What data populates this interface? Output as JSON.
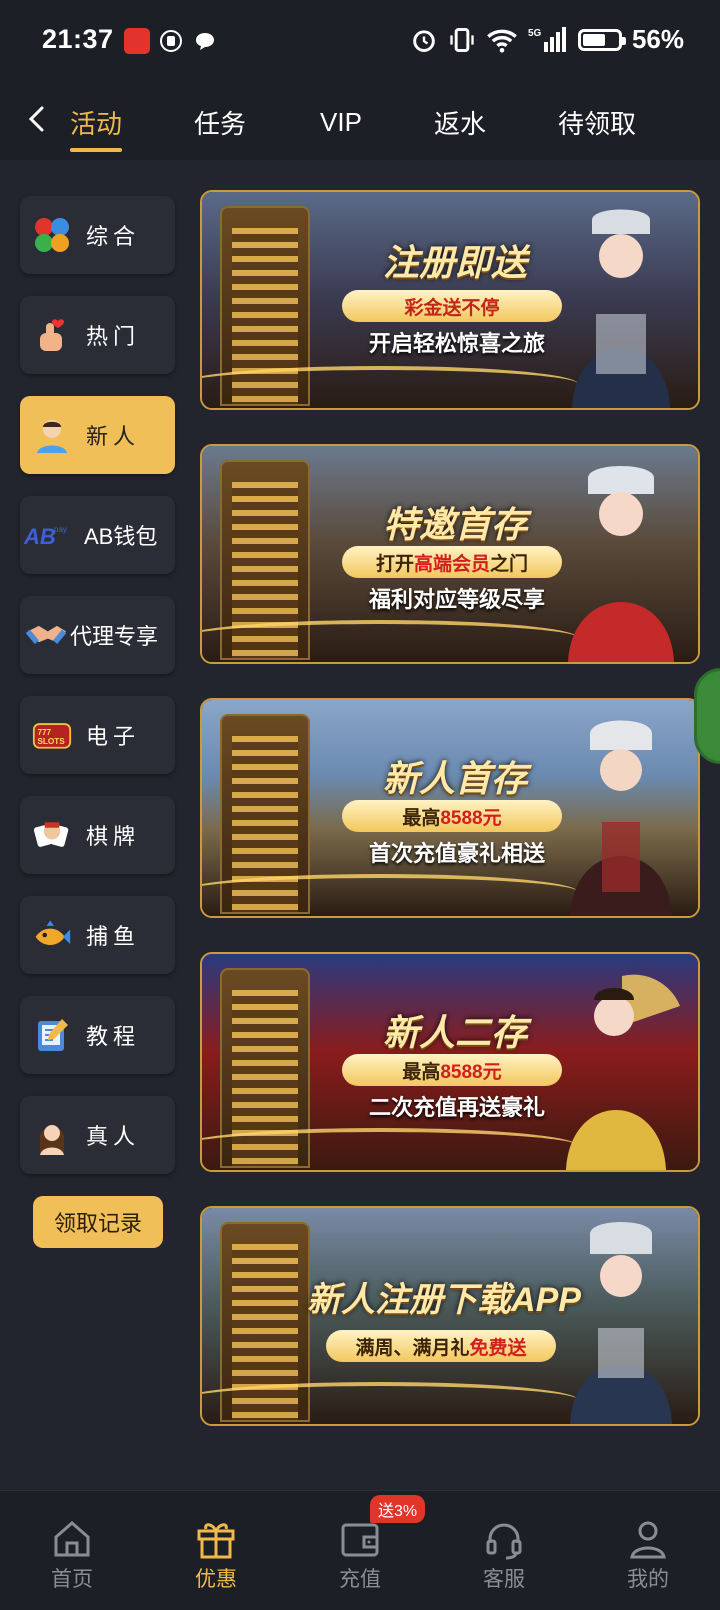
{
  "status_bar": {
    "time": "21:37",
    "battery": "56%",
    "network": "5G"
  },
  "nav": {
    "back_icon": "chevron-left-icon",
    "tabs": [
      {
        "label": "活动",
        "active": true
      },
      {
        "label": "任务"
      },
      {
        "label": "VIP"
      },
      {
        "label": "返水"
      },
      {
        "label": "待领取"
      }
    ]
  },
  "sidebar": {
    "items": [
      {
        "label": "综合",
        "icon": "clover-icon"
      },
      {
        "label": "热门",
        "icon": "thumb-heart-icon"
      },
      {
        "label": "新人",
        "icon": "user-icon",
        "active": true
      },
      {
        "label": "AB钱包",
        "icon": "ab-pay-logo"
      },
      {
        "label": "代理专享",
        "icon": "handshake-icon"
      },
      {
        "label": "电子",
        "icon": "slots-icon"
      },
      {
        "label": "棋牌",
        "icon": "cards-icon"
      },
      {
        "label": "捕鱼",
        "icon": "fish-icon"
      },
      {
        "label": "教程",
        "icon": "book-icon"
      },
      {
        "label": "真人",
        "icon": "dealer-icon"
      }
    ],
    "record_button": "领取记录"
  },
  "banners": [
    {
      "title": "注册即送",
      "pill": "彩金送不停",
      "pill_hl": "",
      "pill_tail": "",
      "sub": "开启轻松惊喜之旅"
    },
    {
      "title": "特邀首存",
      "pill": "打开",
      "pill_hl": "高端会员",
      "pill_tail": "之门",
      "sub": "福利对应等级尽享"
    },
    {
      "title": "新人首存",
      "pill": "最高",
      "pill_hl": "8588元",
      "pill_tail": "",
      "sub": "首次充值豪礼相送"
    },
    {
      "title": "新人二存",
      "pill": "最高",
      "pill_hl": "8588元",
      "pill_tail": "",
      "sub": "二次充值再送豪礼"
    },
    {
      "title": "新人注册下载APP",
      "pill": "满周、满月礼",
      "pill_hl": "免费送",
      "pill_tail": "",
      "sub": ""
    }
  ],
  "bottom_nav": {
    "items": [
      {
        "label": "首页",
        "icon": "home-icon"
      },
      {
        "label": "优惠",
        "icon": "gift-icon",
        "active": true
      },
      {
        "label": "充值",
        "icon": "wallet-icon",
        "badge": "送3%"
      },
      {
        "label": "客服",
        "icon": "headset-icon"
      },
      {
        "label": "我的",
        "icon": "profile-icon"
      }
    ]
  },
  "colors": {
    "accent": "#f0b94a",
    "background": "#22252d"
  }
}
